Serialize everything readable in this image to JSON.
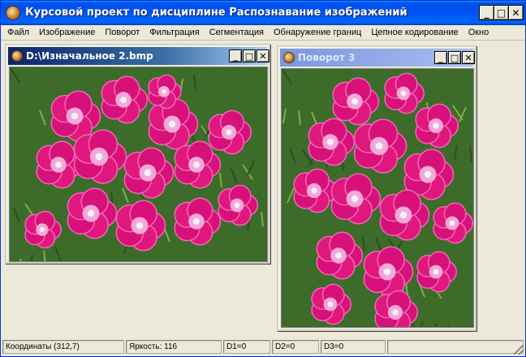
{
  "app": {
    "title": "Курсовой проект по дисциплине Распознавание изображений",
    "minimize": "_",
    "maximize": "□",
    "close": "✕"
  },
  "menu": [
    "Файл",
    "Изображение",
    "Поворот",
    "Фильтрация",
    "Сегментация",
    "Обнаружение границ",
    "Цепное кодирование",
    "Окно"
  ],
  "windows": {
    "original": {
      "title": "D:\\Изначальное 2.bmp",
      "image": "flower-bouquet-photo"
    },
    "rotated": {
      "title": "Поворот 3",
      "image": "flower-bouquet-photo-rotated"
    }
  },
  "status": {
    "coords": "Координаты (312,7)",
    "brightness": "Яркость: 116",
    "d1": "D1=0",
    "d2": "D2=0",
    "d3": "D3=0"
  },
  "colors": {
    "titlebar": "#0055e6",
    "flower_petal": "#e0187e",
    "flower_light": "#f06ab8",
    "foliage": "#3d6b2a"
  }
}
